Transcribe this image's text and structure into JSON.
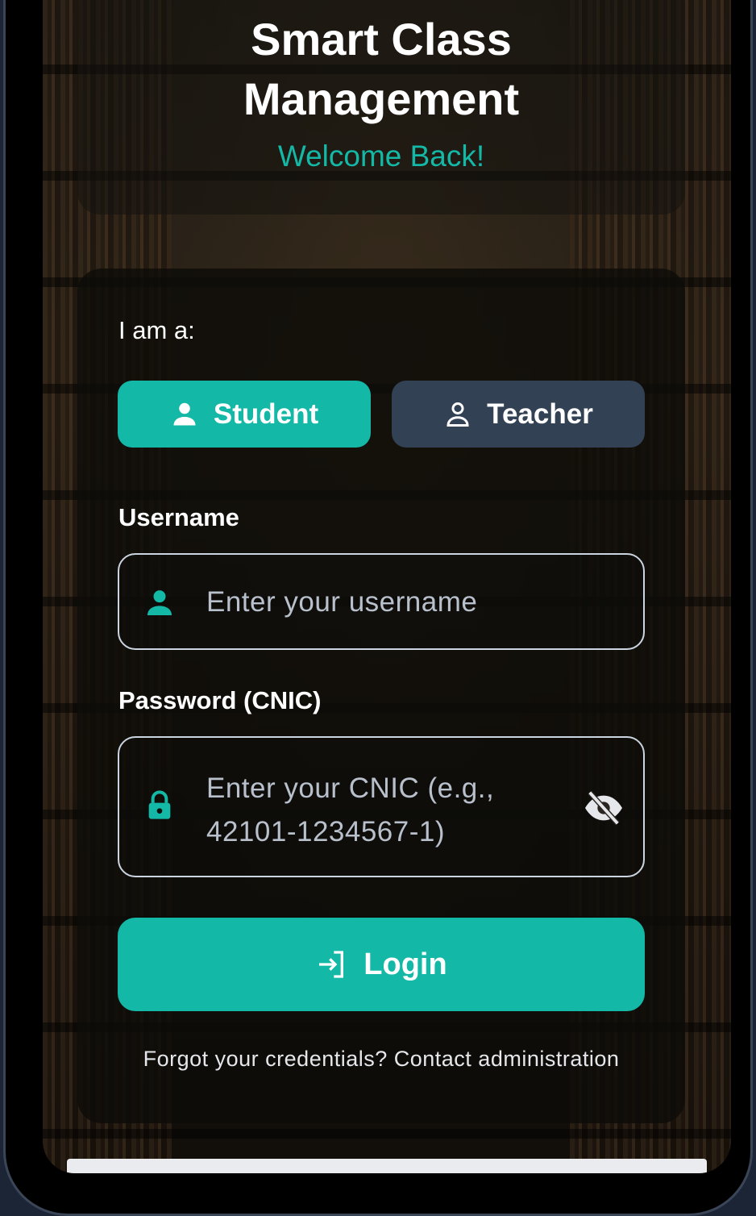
{
  "header": {
    "title_line1": "Smart Class",
    "title_line2": "Management",
    "welcome": "Welcome Back!"
  },
  "role": {
    "label": "I am a:",
    "student_label": "Student",
    "teacher_label": "Teacher",
    "selected": "Student"
  },
  "username": {
    "label": "Username",
    "placeholder": "Enter your username"
  },
  "password": {
    "label": "Password (CNIC)",
    "placeholder_line1": "Enter your CNIC (e.g.,",
    "placeholder_line2": "42101-1234567-1)"
  },
  "login": {
    "label": "Login"
  },
  "footer": {
    "forgot_text": "Forgot your credentials? Contact administration"
  },
  "colors": {
    "accent": "#14b8a6",
    "secondary_button": "#334155",
    "text": "#ffffff"
  },
  "icons": {
    "student": "person-filled-icon",
    "teacher": "person-outline-icon",
    "username": "person-filled-icon",
    "password": "lock-icon",
    "visibility": "eye-off-icon",
    "login": "login-arrow-icon"
  }
}
